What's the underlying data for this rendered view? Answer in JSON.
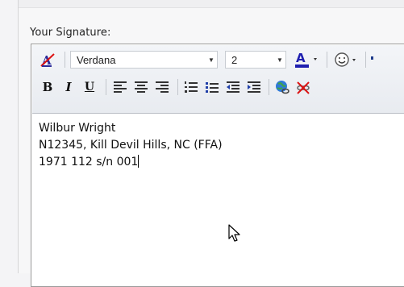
{
  "signature": {
    "label": "Your Signature:",
    "font": "Verdana",
    "size": "2",
    "lines": [
      "Wilbur Wright",
      "N12345, Kill Devil Hills, NC (FFA)",
      "1971 112 s/n 001"
    ]
  },
  "icons": {
    "row1": [
      "clear-formatting-icon",
      "font-color-icon",
      "emoticon-icon",
      "more-icon"
    ],
    "row2": [
      "bold-icon",
      "italic-icon",
      "underline-icon",
      "align-left-icon",
      "align-center-icon",
      "align-right-icon",
      "numbered-list-icon",
      "bullet-list-icon",
      "outdent-icon",
      "indent-icon",
      "insert-link-icon",
      "remove-link-icon",
      "mouse-pointer-icon"
    ]
  },
  "colors": {
    "font_color_bar": "#1f1fb0",
    "editor_border": "#9a9a9a"
  }
}
